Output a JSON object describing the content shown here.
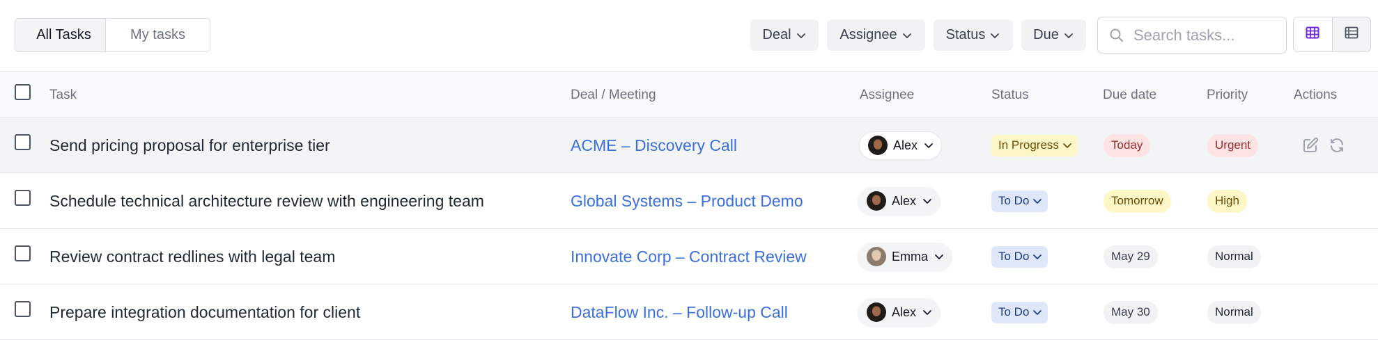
{
  "tabs": {
    "all": "All Tasks",
    "mine": "My tasks"
  },
  "filters": [
    {
      "label": "Deal"
    },
    {
      "label": "Assignee"
    },
    {
      "label": "Status"
    },
    {
      "label": "Due"
    }
  ],
  "search": {
    "placeholder": "Search tasks...",
    "value": ""
  },
  "columns": {
    "task": "Task",
    "deal": "Deal / Meeting",
    "assignee": "Assignee",
    "status": "Status",
    "due": "Due date",
    "priority": "Priority",
    "actions": "Actions"
  },
  "rows": [
    {
      "task": "Send pricing proposal for enterprise tier",
      "deal": "ACME – Discovery Call",
      "assignee": "Alex",
      "status": "In Progress",
      "due": "Today",
      "priority": "Urgent"
    },
    {
      "task": "Schedule technical architecture review with engineering team",
      "deal": "Global Systems – Product Demo",
      "assignee": "Alex",
      "status": "To Do",
      "due": "Tomorrow",
      "priority": "High"
    },
    {
      "task": "Review contract redlines with legal team",
      "deal": "Innovate Corp – Contract Review",
      "assignee": "Emma",
      "status": "To Do",
      "due": "May 29",
      "priority": "Normal"
    },
    {
      "task": "Prepare integration documentation for client",
      "deal": "DataFlow Inc. – Follow-up Call",
      "assignee": "Alex",
      "status": "To Do",
      "due": "May 30",
      "priority": "Normal"
    }
  ],
  "colors": {
    "link": "#3b6fe0",
    "accent": "#6d28d9",
    "urgent_bg": "#fde3e3",
    "in_progress_bg": "#fdf6c7",
    "todo_bg": "#dfe8fb"
  },
  "icons": {
    "search": "search-icon",
    "grid_view": "grid-view-icon",
    "list_view": "list-view-icon",
    "edit": "edit-icon",
    "reassign": "refresh-icon",
    "chevron": "chevron-down-icon"
  }
}
